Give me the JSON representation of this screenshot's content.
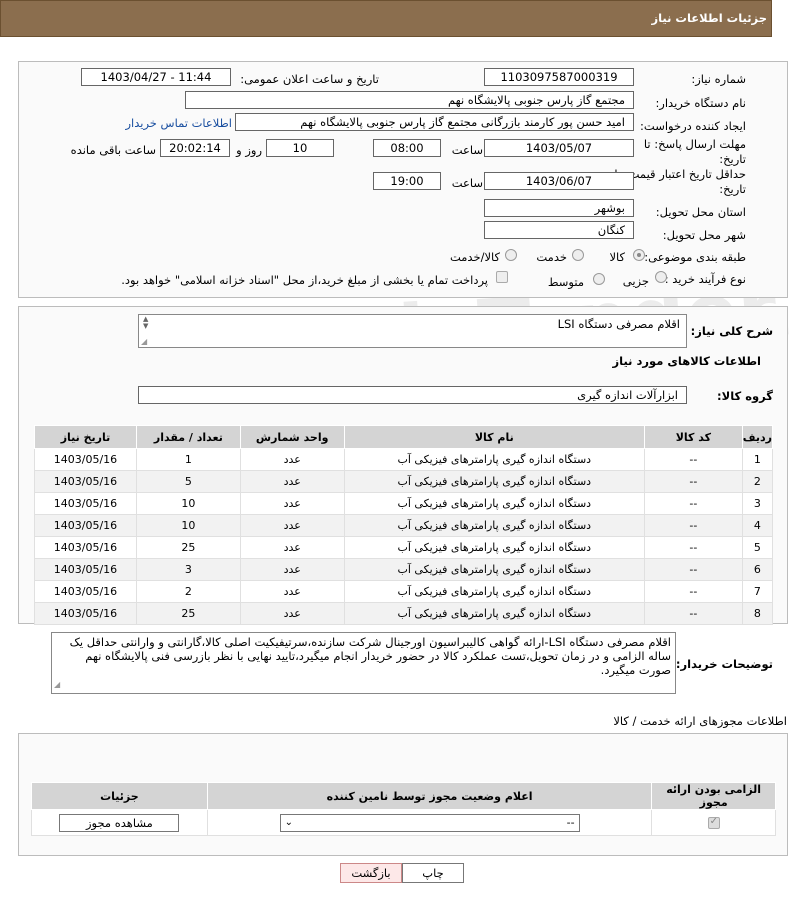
{
  "header": {
    "title": "جزئیات اطلاعات نیاز"
  },
  "form": {
    "need_number_label": "شماره نیاز:",
    "need_number": "1103097587000319",
    "announce_label": "تاریخ و ساعت اعلان عمومی:",
    "announce_value": "1403/04/27 - 11:44",
    "buyer_org_label": "نام دستگاه خریدار:",
    "buyer_org": "مجتمع گاز پارس جنوبی  پالایشگاه نهم",
    "creator_label": "ایجاد کننده درخواست:",
    "creator": "امید حسن پور کارمند بازرگانی مجتمع گاز پارس جنوبی  پالایشگاه نهم",
    "contact_link": "اطلاعات تماس خریدار",
    "reply_deadline_label": "مهلت ارسال پاسخ: تا تاریخ:",
    "reply_date": "1403/05/07",
    "time_word": "ساعت",
    "reply_time": "08:00",
    "days_value": "10",
    "days_word": "روز و",
    "remaining_time": "20:02:14",
    "remaining_word": "ساعت باقی مانده",
    "price_deadline_label": "حداقل تاریخ اعتبار قیمت: تا تاریخ:",
    "price_date": "1403/06/07",
    "price_time": "19:00",
    "province_label": "استان محل تحویل:",
    "province": "بوشهر",
    "city_label": "شهر محل تحویل:",
    "city": "کنگان",
    "category_label": "طبقه بندی موضوعی:",
    "category_options": [
      "کالا",
      "خدمت",
      "کالا/خدمت"
    ],
    "process_label": "نوع فرآیند خرید :",
    "process_options": [
      "جزیی",
      "متوسط"
    ],
    "process_note": "پرداخت تمام یا بخشی از مبلغ خرید،از محل \"اسناد خزانه اسلامی\" خواهد بود."
  },
  "need": {
    "summary_label": "شرح کلی نیاز:",
    "summary": "اقلام مصرفی دستگاه LSI",
    "goods_info_title": "اطلاعات کالاهای مورد نیاز",
    "group_label": "گروه کالا:",
    "group_value": "ابزارآلات اندازه گیری"
  },
  "items_table": {
    "headers": [
      "ردیف",
      "کد کالا",
      "نام کالا",
      "واحد شمارش",
      "تعداد / مقدار",
      "تاریخ نیاز"
    ],
    "rows": [
      [
        "1",
        "--",
        "دستگاه اندازه گیری پارامترهای فیزیکی آب",
        "عدد",
        "1",
        "1403/05/16"
      ],
      [
        "2",
        "--",
        "دستگاه اندازه گیری پارامترهای فیزیکی آب",
        "عدد",
        "5",
        "1403/05/16"
      ],
      [
        "3",
        "--",
        "دستگاه اندازه گیری پارامترهای فیزیکی آب",
        "عدد",
        "10",
        "1403/05/16"
      ],
      [
        "4",
        "--",
        "دستگاه اندازه گیری پارامترهای فیزیکی آب",
        "عدد",
        "10",
        "1403/05/16"
      ],
      [
        "5",
        "--",
        "دستگاه اندازه گیری پارامترهای فیزیکی آب",
        "عدد",
        "25",
        "1403/05/16"
      ],
      [
        "6",
        "--",
        "دستگاه اندازه گیری پارامترهای فیزیکی آب",
        "عدد",
        "3",
        "1403/05/16"
      ],
      [
        "7",
        "--",
        "دستگاه اندازه گیری پارامترهای فیزیکی آب",
        "عدد",
        "2",
        "1403/05/16"
      ],
      [
        "8",
        "--",
        "دستگاه اندازه گیری پارامترهای فیزیکی آب",
        "عدد",
        "25",
        "1403/05/16"
      ]
    ]
  },
  "buyer_notes": {
    "label": "توضیحات خریدار:",
    "text": "اقلام مصرفی دستگاه LSI-ارائه گواهی کالیبراسیون اورجینال شرکت سازنده،سرتیفیکیت اصلی کالا،گارانتی و وارانتی حداقل یک ساله الزامی و در زمان تحویل،تست عملکرد کالا در حضور خریدار انجام میگیرد،تایید نهایی با نظر بازرسی فنی پالایشگاه نهم صورت میگیرد."
  },
  "permits": {
    "title": "اطلاعات مجوزهای ارائه خدمت / کالا",
    "headers": [
      "الزامی بودن ارائه مجوز",
      "اعلام وضعیت مجوز توسط نامین کننده",
      "جزئیات"
    ],
    "select_value": "--",
    "view_button": "مشاهده مجوز"
  },
  "footer": {
    "print": "چاپ",
    "back": "بازگشت"
  },
  "watermark": "AriaTender.net"
}
